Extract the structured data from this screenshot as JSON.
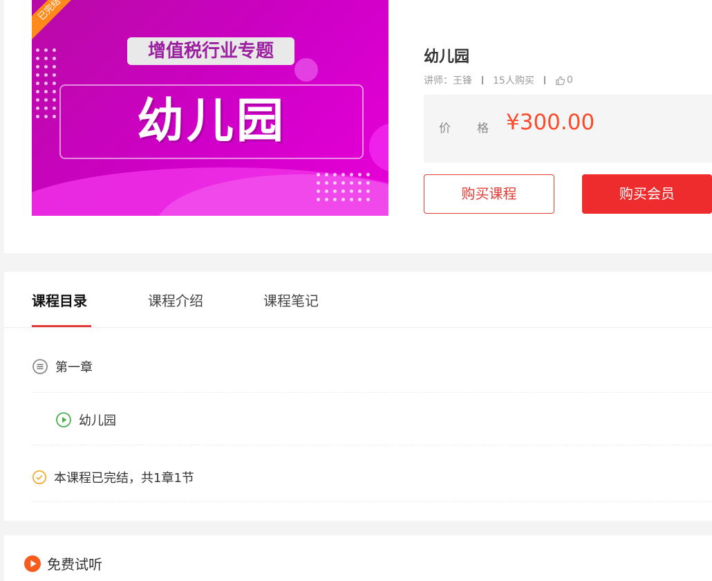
{
  "cover": {
    "ribbon": "已完结",
    "series_title": "增值税行业专题",
    "big_title": "幼儿园"
  },
  "course": {
    "title": "幼儿园",
    "teacher": "讲师：王锋",
    "buyers": "15人购买",
    "likes": "0",
    "price_label": "价格",
    "price": "¥300.00",
    "buy_course_label": "购买课程",
    "buy_member_label": "购买会员"
  },
  "tabs": [
    {
      "label": "课程目录",
      "active": true
    },
    {
      "label": "课程介绍",
      "active": false
    },
    {
      "label": "课程笔记",
      "active": false
    }
  ],
  "catalog": {
    "chapter": "第一章",
    "lesson": "幼儿园",
    "status": "本课程已完结，共1章1节"
  },
  "trial": {
    "label": "免费试听"
  },
  "colors": {
    "accent_red": "#e33b36",
    "price_orange": "#fb4a2a",
    "play_green": "#4caf50",
    "status_orange": "#f5a623",
    "trial_orange": "#f45d1e"
  },
  "icons": {
    "chapter": "list-circle-icon",
    "lesson": "play-circle-icon",
    "status": "check-circle-icon",
    "likes": "thumbs-up-icon",
    "trial": "play-circle-filled-icon"
  }
}
